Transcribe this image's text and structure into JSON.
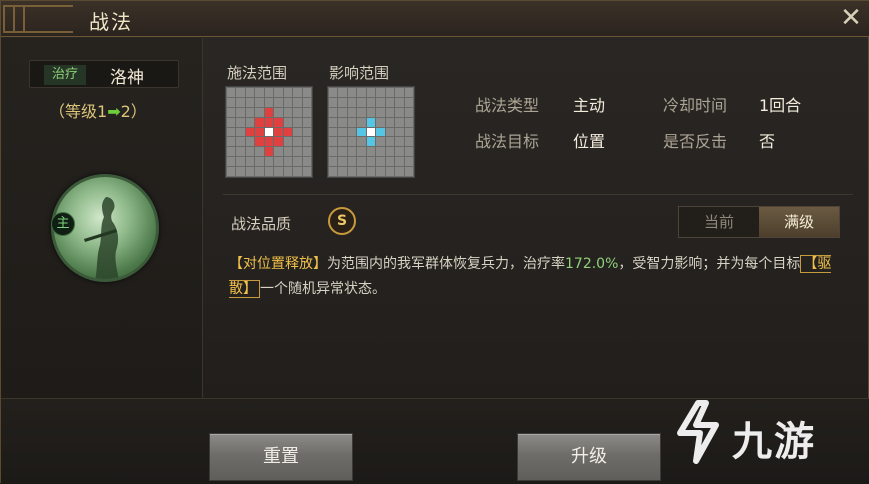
{
  "window": {
    "title": "战法"
  },
  "hero": {
    "type_tag": "治疗",
    "name": "洛神",
    "level_prefix": "（等级1",
    "level_arrow": "➡",
    "level_suffix": "2）",
    "badge": "主"
  },
  "range": {
    "cast_label": "施法范围",
    "effect_label": "影响范围"
  },
  "info": {
    "type_label": "战法类型",
    "type_value": "主动",
    "cooldown_label": "冷却时间",
    "cooldown_value": "1回合",
    "target_label": "战法目标",
    "target_value": "位置",
    "counter_label": "是否反击",
    "counter_value": "否"
  },
  "quality": {
    "label": "战法品质",
    "grade": "S"
  },
  "toggle": {
    "current": "当前",
    "max": "满级"
  },
  "description": {
    "tag1": "【对位置释放】",
    "part1": "为范围内的我军群体恢复兵力，治疗率",
    "rate": "172.0%",
    "part2": "，受智力影响；并为每个目标",
    "tag2": "【驱散】",
    "part3": "一个随机异常状态。"
  },
  "buttons": {
    "reset": "重置",
    "upgrade": "升级"
  },
  "colors": {
    "accent": "#c79a3c",
    "heal_green": "#8fd07a",
    "cast_red": "#e04040",
    "effect_blue": "#55c5e6"
  }
}
